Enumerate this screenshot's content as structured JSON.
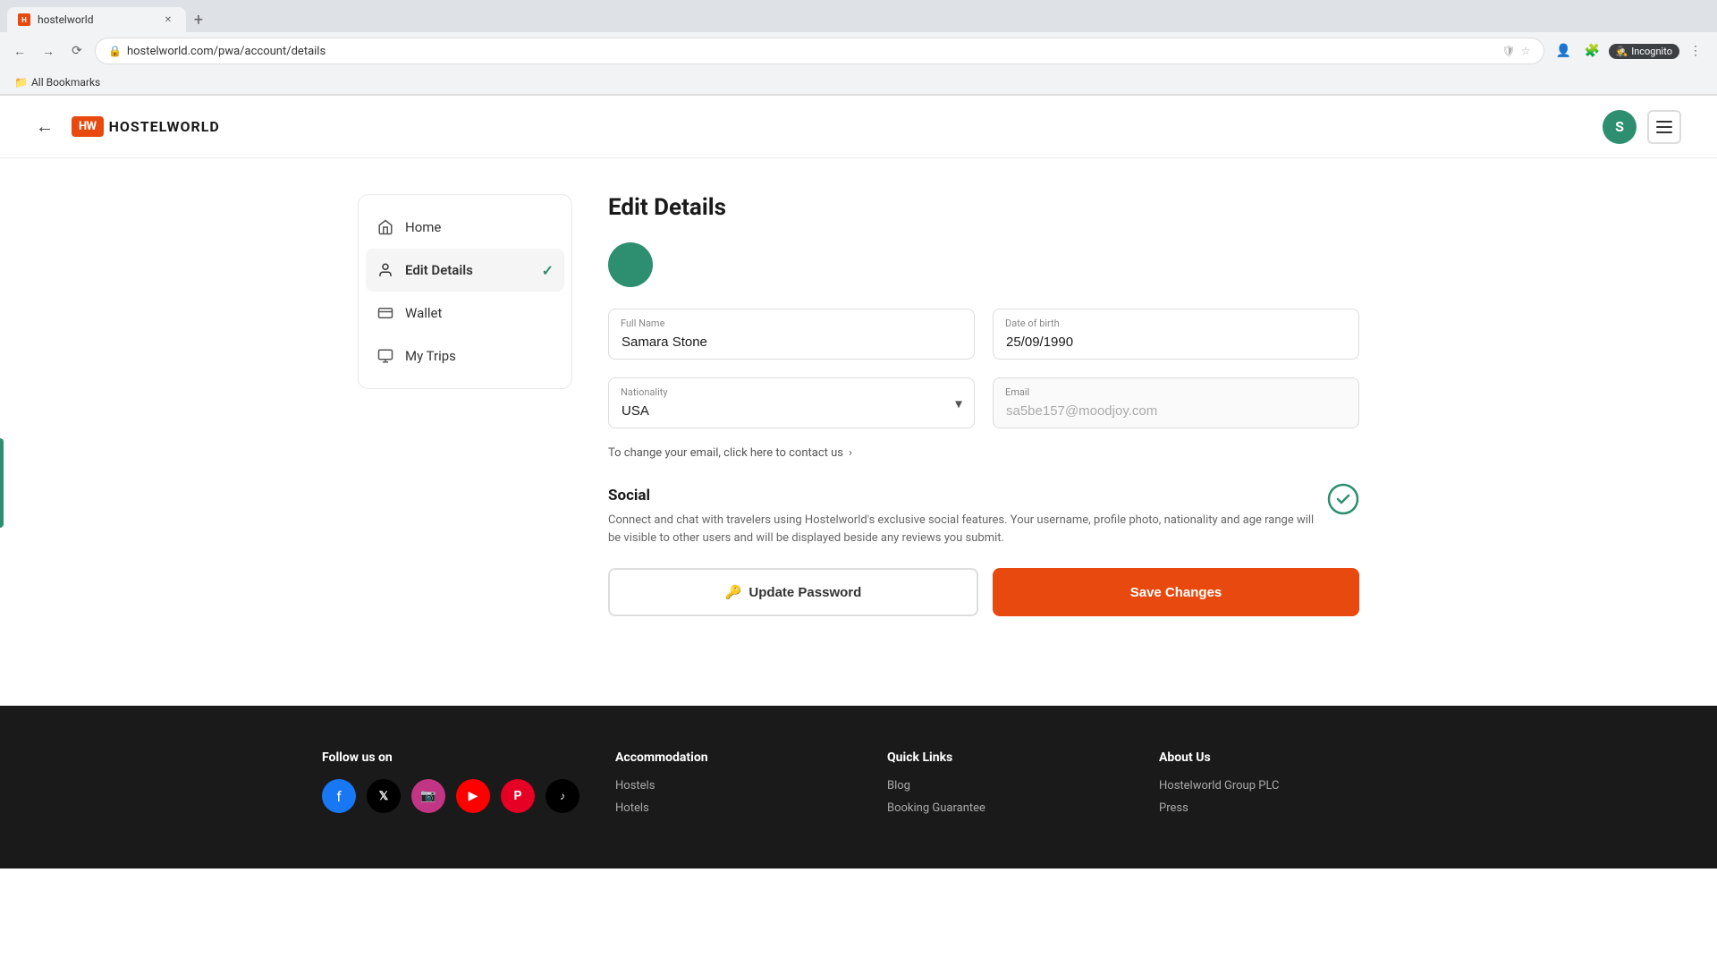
{
  "browser": {
    "tab_label": "hostelworld",
    "url": "hostelworld.com/pwa/account/details",
    "bookmarks_label": "All Bookmarks",
    "incognito_label": "Incognito"
  },
  "header": {
    "logo_box": "HW",
    "logo_text": "HOSTELWORLD",
    "avatar_letter": "S"
  },
  "sidebar": {
    "items": [
      {
        "id": "home",
        "label": "Home",
        "active": false
      },
      {
        "id": "edit-details",
        "label": "Edit Details",
        "active": true
      },
      {
        "id": "wallet",
        "label": "Wallet",
        "active": false
      },
      {
        "id": "my-trips",
        "label": "My Trips",
        "active": false
      }
    ]
  },
  "content": {
    "page_title": "Edit Details",
    "form": {
      "full_name_label": "Full Name",
      "full_name_value": "Samara Stone",
      "dob_label": "Date of birth",
      "dob_value": "25/09/1990",
      "nationality_label": "Nationality",
      "nationality_value": "USA",
      "email_label": "Email",
      "email_value": "sa5be157@moodjoy.com",
      "email_link_text": "To change your email, click here to contact us"
    },
    "social": {
      "title": "Social",
      "description": "Connect and chat with travelers using Hostelworld's exclusive social features. Your username, profile photo, nationality and age range will be visible to other users and will be displayed beside any reviews you submit."
    },
    "buttons": {
      "update_password": "Update Password",
      "save_changes": "Save Changes"
    }
  },
  "footer": {
    "follow_us": {
      "title": "Follow us on",
      "socials": [
        "facebook",
        "x",
        "instagram",
        "youtube",
        "pinterest",
        "tiktok"
      ]
    },
    "accommodation": {
      "title": "Accommodation",
      "links": [
        "Hostels",
        "Hotels"
      ]
    },
    "quick_links": {
      "title": "Quick Links",
      "links": [
        "Blog",
        "Booking Guarantee"
      ]
    },
    "about_us": {
      "title": "About Us",
      "links": [
        "Hostelworld Group PLC",
        "Press"
      ]
    }
  }
}
